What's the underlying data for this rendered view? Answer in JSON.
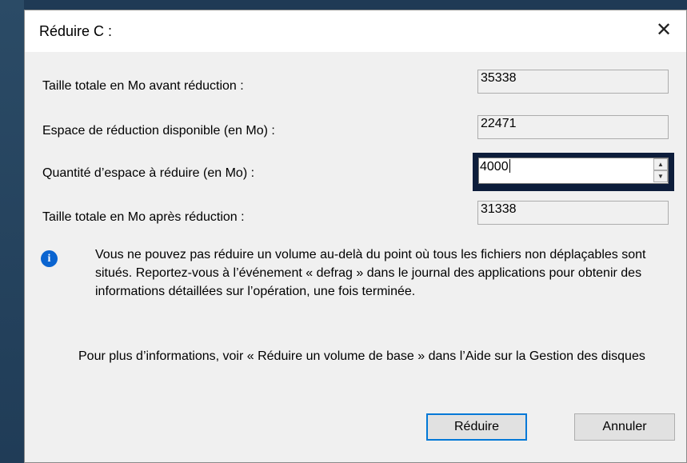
{
  "dialog": {
    "title": "Réduire C :",
    "close_glyph": "✕"
  },
  "fields": {
    "total_before_label": "Taille totale en Mo avant réduction :",
    "total_before_value": "35338",
    "available_label": "Espace de réduction disponible (en Mo) :",
    "available_value": "22471",
    "shrink_amount_label": "Quantité d’espace à réduire (en Mo) :",
    "shrink_amount_value": "4000",
    "total_after_label": "Taille totale en Mo après réduction :",
    "total_after_value": "31338"
  },
  "info": {
    "icon": "info-icon",
    "text": "Vous ne pouvez pas réduire un volume au-delà du point où tous les fichiers non déplaçables sont situés. Reportez-vous à l’événement « defrag » dans le journal des applications pour obtenir des informations détaillées sur l’opération, une fois terminée."
  },
  "help": {
    "text": "Pour plus d’informations, voir « Réduire un volume de base » dans l’Aide sur la Gestion des disques"
  },
  "buttons": {
    "shrink_label": "Réduire",
    "cancel_label": "Annuler"
  },
  "colors": {
    "dialog_bg": "#f0f0f0",
    "focus_highlight": "#0d1d3b",
    "info_blue": "#0a64d0",
    "default_button_border": "#0078d7"
  }
}
